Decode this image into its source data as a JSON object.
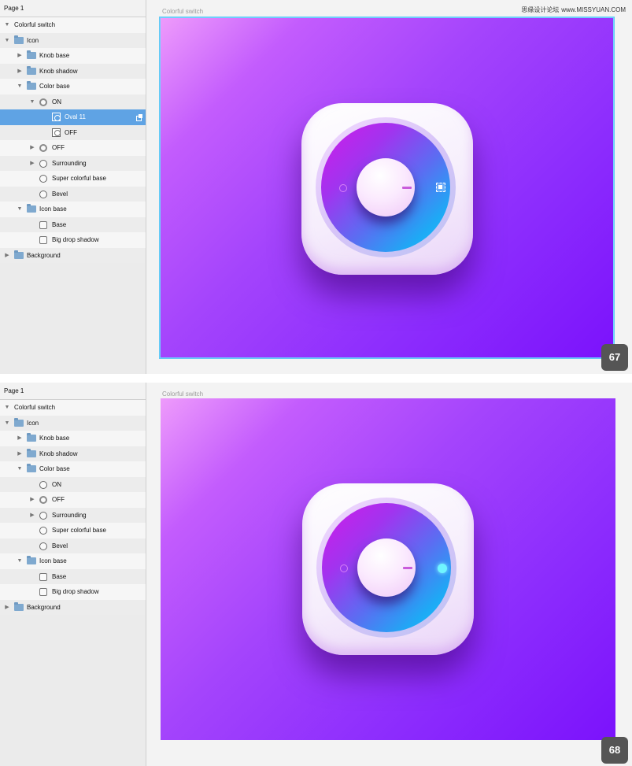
{
  "watermark": {
    "text": "思缘设计论坛",
    "url": "www.MISSYUAN.COM"
  },
  "panels": [
    {
      "page_title": "Page 1",
      "canvas_title": "Colorful switch",
      "step": "67",
      "layers": [
        {
          "label": "Colorful switch",
          "depth": 0,
          "arrow": "down",
          "icon": "none"
        },
        {
          "label": "Icon",
          "depth": 0,
          "arrow": "down",
          "icon": "folder"
        },
        {
          "label": "Knob base",
          "depth": 1,
          "arrow": "right",
          "icon": "folder"
        },
        {
          "label": "Knob shadow",
          "depth": 1,
          "arrow": "right",
          "icon": "folder"
        },
        {
          "label": "Color base",
          "depth": 1,
          "arrow": "down",
          "icon": "folder"
        },
        {
          "label": "ON",
          "depth": 2,
          "arrow": "down",
          "icon": "circle-thick"
        },
        {
          "label": "Oval 11",
          "depth": 3,
          "arrow": "none",
          "icon": "oval-box",
          "selected": true
        },
        {
          "label": "OFF",
          "depth": 3,
          "arrow": "none",
          "icon": "oval-box"
        },
        {
          "label": "OFF",
          "depth": 2,
          "arrow": "right",
          "icon": "circle-thick"
        },
        {
          "label": "Surrounding",
          "depth": 2,
          "arrow": "right",
          "icon": "circle"
        },
        {
          "label": "Super colorful base",
          "depth": 2,
          "arrow": "none",
          "icon": "circle"
        },
        {
          "label": "Bevel",
          "depth": 2,
          "arrow": "none",
          "icon": "circle"
        },
        {
          "label": "Icon base",
          "depth": 1,
          "arrow": "down",
          "icon": "folder"
        },
        {
          "label": "Base",
          "depth": 2,
          "arrow": "none",
          "icon": "square"
        },
        {
          "label": "Big drop shadow",
          "depth": 2,
          "arrow": "none",
          "icon": "square"
        },
        {
          "label": "Background",
          "depth": 0,
          "arrow": "right",
          "icon": "folder"
        }
      ]
    },
    {
      "page_title": "Page 1",
      "canvas_title": "Colorful switch",
      "step": "68",
      "layers": [
        {
          "label": "Colorful switch",
          "depth": 0,
          "arrow": "down",
          "icon": "none"
        },
        {
          "label": "Icon",
          "depth": 0,
          "arrow": "down",
          "icon": "folder"
        },
        {
          "label": "Knob base",
          "depth": 1,
          "arrow": "right",
          "icon": "folder"
        },
        {
          "label": "Knob shadow",
          "depth": 1,
          "arrow": "right",
          "icon": "folder"
        },
        {
          "label": "Color base",
          "depth": 1,
          "arrow": "down",
          "icon": "folder"
        },
        {
          "label": "ON",
          "depth": 2,
          "arrow": "none",
          "icon": "circle"
        },
        {
          "label": "OFF",
          "depth": 2,
          "arrow": "right",
          "icon": "circle-thick"
        },
        {
          "label": "Surrounding",
          "depth": 2,
          "arrow": "right",
          "icon": "circle"
        },
        {
          "label": "Super colorful base",
          "depth": 2,
          "arrow": "none",
          "icon": "circle"
        },
        {
          "label": "Bevel",
          "depth": 2,
          "arrow": "none",
          "icon": "circle"
        },
        {
          "label": "Icon base",
          "depth": 1,
          "arrow": "down",
          "icon": "folder"
        },
        {
          "label": "Base",
          "depth": 2,
          "arrow": "none",
          "icon": "square"
        },
        {
          "label": "Big drop shadow",
          "depth": 2,
          "arrow": "none",
          "icon": "square"
        },
        {
          "label": "Background",
          "depth": 0,
          "arrow": "right",
          "icon": "folder"
        }
      ]
    }
  ],
  "colors": {
    "selection": "#5fa3e4",
    "background_start": "#ee9bfb",
    "background_end": "#7b12fc",
    "ring_start": "#d21be8",
    "ring_end": "#17c7fb",
    "on_indicator": "#6ff5ff"
  }
}
